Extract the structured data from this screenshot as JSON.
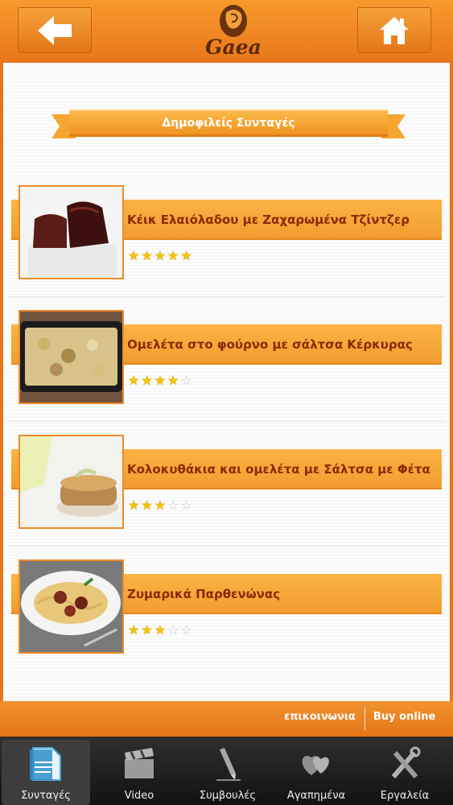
{
  "header": {
    "back_icon": "arrow-left-icon",
    "home_icon": "home-icon",
    "logo_text": "Gaea"
  },
  "section": {
    "title": "Δημοφιλείς Συνταγές"
  },
  "recipes": [
    {
      "title": "Κέικ Ελαιόλαδου με Ζαχαρωμένα Τζίντζερ",
      "rating": 5,
      "max_rating": 5,
      "thumb": "chocolate-cake"
    },
    {
      "title": "Ομελέτα στο φούρνο με σάλτσα Κέρκυρας",
      "rating": 4,
      "max_rating": 5,
      "thumb": "baked-omelette"
    },
    {
      "title": "Κολοκυθάκια και ομελέτα με Σάλτσα με Φέτα",
      "rating": 3,
      "max_rating": 5,
      "thumb": "zucchini-omelette"
    },
    {
      "title": "Ζυμαρικά Παρθενώνας",
      "rating": 3,
      "max_rating": 5,
      "thumb": "spaghetti-meatballs"
    }
  ],
  "footer": {
    "contact_label": "επικοινωνια",
    "buy_label": "Buy online"
  },
  "tabs": [
    {
      "label": "Συνταγές",
      "icon": "document-icon",
      "active": true
    },
    {
      "label": "Video",
      "icon": "clapperboard-icon",
      "active": false
    },
    {
      "label": "Συμβουλές",
      "icon": "pencil-icon",
      "active": false
    },
    {
      "label": "Αγαπημένα",
      "icon": "hearts-icon",
      "active": false
    },
    {
      "label": "Εργαλεία",
      "icon": "tools-icon",
      "active": false
    }
  ],
  "colors": {
    "brand_orange": "#e9761a",
    "title_text": "#8a2a06",
    "star_on": "#f5c400"
  }
}
